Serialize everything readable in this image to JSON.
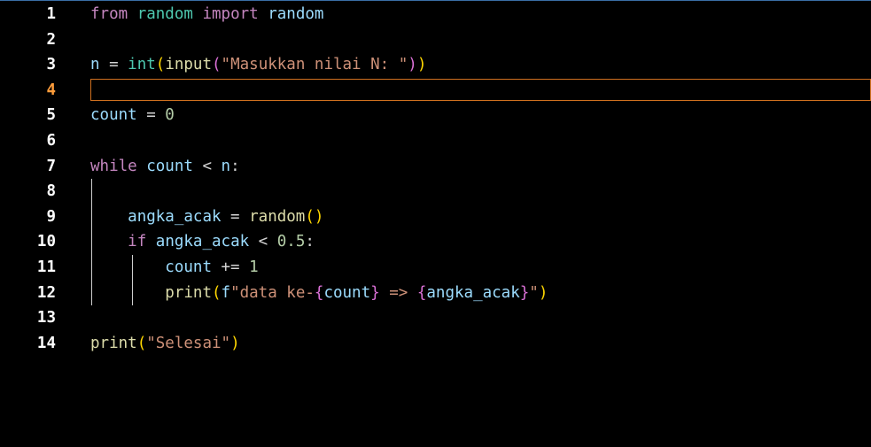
{
  "editor": {
    "active_line": 4,
    "lines": [
      {
        "number": "1",
        "tokens": [
          {
            "t": "from",
            "c": "kw"
          },
          {
            "t": " ",
            "c": "op"
          },
          {
            "t": "random",
            "c": "mod"
          },
          {
            "t": " ",
            "c": "op"
          },
          {
            "t": "import",
            "c": "kw"
          },
          {
            "t": " ",
            "c": "op"
          },
          {
            "t": "random",
            "c": "var"
          }
        ]
      },
      {
        "number": "2",
        "tokens": []
      },
      {
        "number": "3",
        "tokens": [
          {
            "t": "n",
            "c": "var"
          },
          {
            "t": " = ",
            "c": "op"
          },
          {
            "t": "int",
            "c": "mod"
          },
          {
            "t": "(",
            "c": "br1"
          },
          {
            "t": "input",
            "c": "fn"
          },
          {
            "t": "(",
            "c": "br2"
          },
          {
            "t": "\"Masukkan nilai N: \"",
            "c": "str"
          },
          {
            "t": ")",
            "c": "br2"
          },
          {
            "t": ")",
            "c": "br1"
          }
        ]
      },
      {
        "number": "4",
        "tokens": []
      },
      {
        "number": "5",
        "tokens": [
          {
            "t": "count",
            "c": "var"
          },
          {
            "t": " = ",
            "c": "op"
          },
          {
            "t": "0",
            "c": "num"
          }
        ]
      },
      {
        "number": "6",
        "tokens": []
      },
      {
        "number": "7",
        "tokens": [
          {
            "t": "while",
            "c": "kw"
          },
          {
            "t": " ",
            "c": "op"
          },
          {
            "t": "count",
            "c": "var"
          },
          {
            "t": " < ",
            "c": "op"
          },
          {
            "t": "n",
            "c": "var"
          },
          {
            "t": ":",
            "c": "op"
          }
        ]
      },
      {
        "number": "8",
        "tokens": []
      },
      {
        "number": "9",
        "tokens": [
          {
            "t": "    ",
            "c": "op"
          },
          {
            "t": "angka_acak",
            "c": "var"
          },
          {
            "t": " = ",
            "c": "op"
          },
          {
            "t": "random",
            "c": "fn"
          },
          {
            "t": "(",
            "c": "br1"
          },
          {
            "t": ")",
            "c": "br1"
          }
        ]
      },
      {
        "number": "10",
        "tokens": [
          {
            "t": "    ",
            "c": "op"
          },
          {
            "t": "if",
            "c": "kw"
          },
          {
            "t": " ",
            "c": "op"
          },
          {
            "t": "angka_acak",
            "c": "var"
          },
          {
            "t": " < ",
            "c": "op"
          },
          {
            "t": "0.5",
            "c": "num"
          },
          {
            "t": ":",
            "c": "op"
          }
        ]
      },
      {
        "number": "11",
        "tokens": [
          {
            "t": "        ",
            "c": "op"
          },
          {
            "t": "count",
            "c": "var"
          },
          {
            "t": " += ",
            "c": "op"
          },
          {
            "t": "1",
            "c": "num"
          }
        ]
      },
      {
        "number": "12",
        "tokens": [
          {
            "t": "        ",
            "c": "op"
          },
          {
            "t": "print",
            "c": "fn"
          },
          {
            "t": "(",
            "c": "br1"
          },
          {
            "t": "f",
            "c": "var"
          },
          {
            "t": "\"data ke-",
            "c": "str"
          },
          {
            "t": "{",
            "c": "br2"
          },
          {
            "t": "count",
            "c": "var"
          },
          {
            "t": "}",
            "c": "br2"
          },
          {
            "t": " => ",
            "c": "str"
          },
          {
            "t": "{",
            "c": "br2"
          },
          {
            "t": "angka_acak",
            "c": "var"
          },
          {
            "t": "}",
            "c": "br2"
          },
          {
            "t": "\"",
            "c": "str"
          },
          {
            "t": ")",
            "c": "br1"
          }
        ]
      },
      {
        "number": "13",
        "tokens": []
      },
      {
        "number": "14",
        "tokens": [
          {
            "t": "print",
            "c": "fn"
          },
          {
            "t": "(",
            "c": "br1"
          },
          {
            "t": "\"Selesai\"",
            "c": "str"
          },
          {
            "t": ")",
            "c": "br1"
          }
        ]
      }
    ],
    "indent_guides": [
      {
        "level": 1,
        "from_line": 8,
        "to_line": 12
      },
      {
        "level": 2,
        "from_line": 11,
        "to_line": 12
      }
    ]
  }
}
